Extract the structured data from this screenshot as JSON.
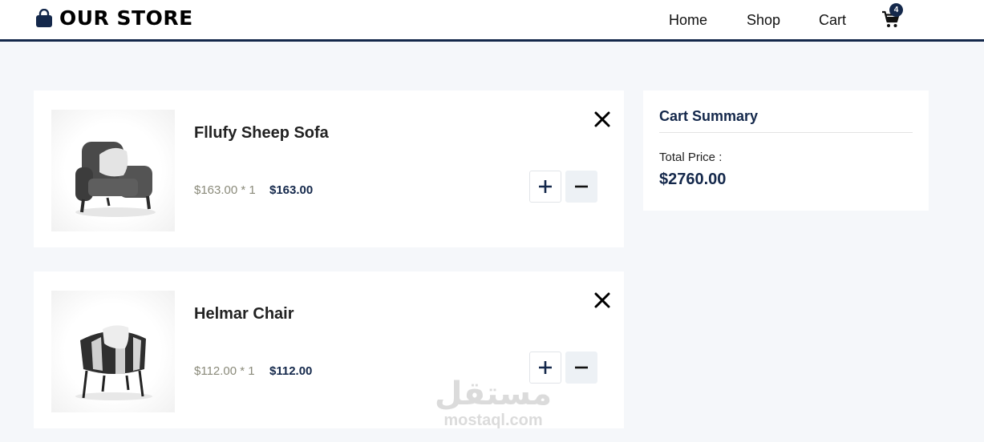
{
  "header": {
    "brand": "OUR STORE",
    "nav": [
      "Home",
      "Shop",
      "Cart"
    ],
    "cart_count": "4"
  },
  "cart": {
    "items": [
      {
        "name": "Fllufy Sheep Sofa",
        "unit_price": "$163.00 * 1",
        "total": "$163.00"
      },
      {
        "name": "Helmar Chair",
        "unit_price": "$112.00 * 1",
        "total": "$112.00"
      }
    ]
  },
  "summary": {
    "title": "Cart Summary",
    "total_label": "Total Price :",
    "total_value": "$2760.00"
  },
  "watermark": {
    "arabic": "مستقل",
    "latin": "mostaql.com"
  },
  "colors": {
    "accent": "#14284b",
    "background": "#f5f7fa",
    "muted_price": "#8a8a7a"
  },
  "icons": [
    "shopping-bag-icon",
    "cart-icon",
    "close-icon",
    "plus-icon",
    "minus-icon"
  ]
}
